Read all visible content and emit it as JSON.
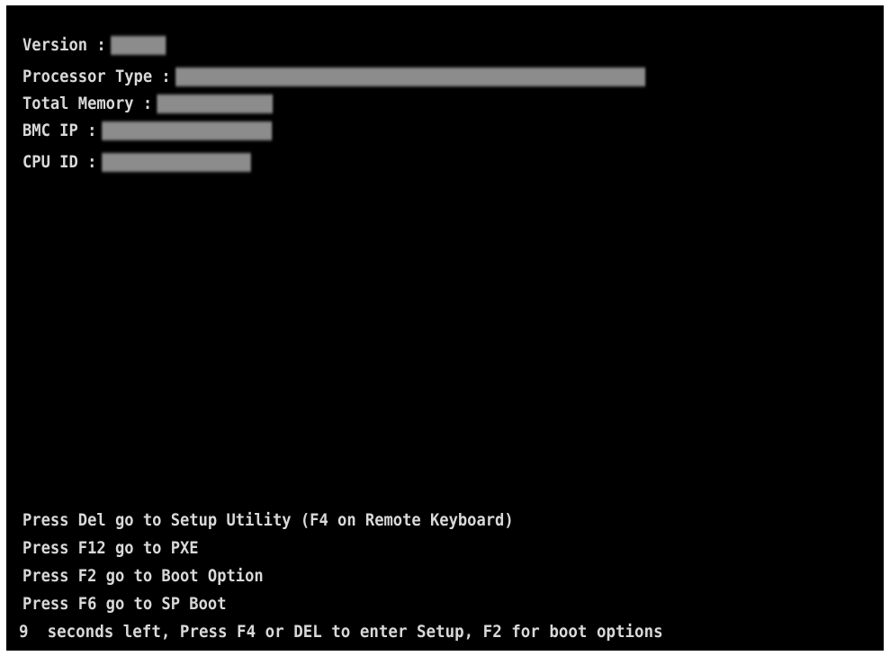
{
  "info": {
    "version_label": "Version :",
    "processor_label": "Processor Type :",
    "memory_label": "Total Memory :",
    "bmc_label": "BMC IP :",
    "cpu_label": "CPU ID :"
  },
  "prompts": {
    "setup": "Press Del go to Setup Utility (F4 on Remote Keyboard)",
    "pxe": "Press F12 go to PXE",
    "boot_option": "Press F2 go to Boot Option",
    "sp_boot": "Press F6 go to SP Boot",
    "countdown": "9  seconds left, Press F4 or DEL to enter Setup, F2 for boot options"
  },
  "colors": {
    "background": "#000000",
    "text": "#d9d9d9",
    "redaction": "#8c8c8c"
  }
}
